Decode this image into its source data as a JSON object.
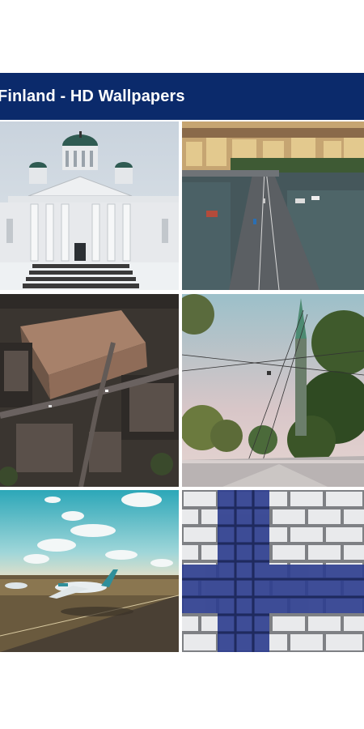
{
  "app_bar": {
    "title": "Finland - HD Wallpapers"
  },
  "wallpapers": [
    {
      "subject": "cathedral-snow"
    },
    {
      "subject": "bridge-aerial"
    },
    {
      "subject": "city-buildings-aerial"
    },
    {
      "subject": "street-tram-wires"
    },
    {
      "subject": "airplane-airport"
    },
    {
      "subject": "finnish-flag-brick-wall"
    }
  ],
  "colors": {
    "app_bar_bg": "#0b2a6b",
    "app_bar_text": "#ffffff",
    "background": "#ffffff"
  }
}
